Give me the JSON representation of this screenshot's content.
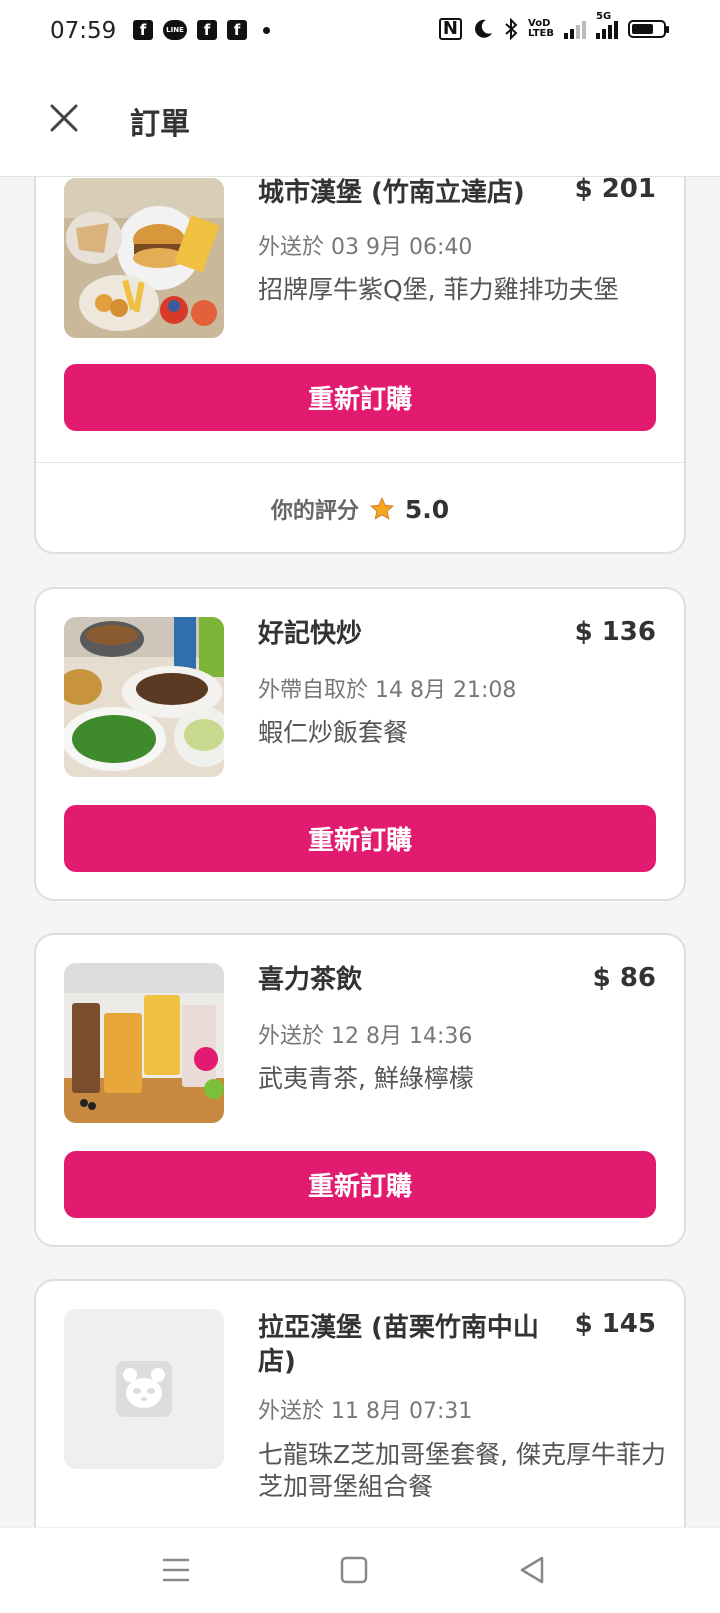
{
  "status_bar": {
    "time": "07:59",
    "left_icons": [
      "facebook-icon",
      "line-icon",
      "facebook-icon",
      "facebook-icon",
      "dot-icon"
    ],
    "line_label": "LINE",
    "volte_top": "VoD",
    "volte_bottom": "LTEB",
    "network": "5G",
    "battery_level": 0.7
  },
  "header": {
    "title": "訂單",
    "close_icon": "close-icon"
  },
  "orders": [
    {
      "shop": "城市漢堡 (竹南立達店)",
      "price": "$ 201",
      "meta": "外送於 03 9月 06:40",
      "items": "招牌厚牛紫Q堡, 菲力雞排功夫堡",
      "reorder_label": "重新訂購",
      "rating_label": "你的評分",
      "rating_value": "5.0"
    },
    {
      "shop": "好記快炒",
      "price": "$ 136",
      "meta": "外帶自取於 14 8月 21:08",
      "items": "蝦仁炒飯套餐",
      "reorder_label": "重新訂購"
    },
    {
      "shop": "喜力茶飲",
      "price": "$ 86",
      "meta": "外送於 12 8月 14:36",
      "items": "武夷青茶, 鮮綠檸檬",
      "reorder_label": "重新訂購"
    },
    {
      "shop": "拉亞漢堡 (苗栗竹南中山店)",
      "price": "$ 145",
      "meta": "外送於 11 8月 07:31",
      "items": "七龍珠Z芝加哥堡套餐, 傑克厚牛菲力芝加哥堡組合餐"
    }
  ],
  "colors": {
    "accent": "#e21b70",
    "star": "#f5a623"
  },
  "nav": {
    "icons": [
      "menu-icon",
      "home-square-icon",
      "back-triangle-icon"
    ]
  }
}
